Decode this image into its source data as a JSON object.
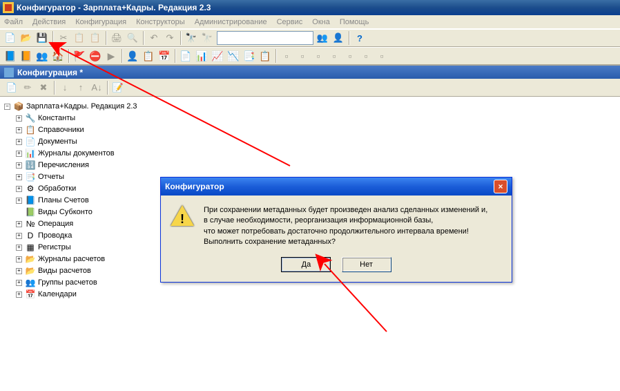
{
  "titlebar": {
    "text": "Конфигуратор - Зарплата+Кадры. Редакция 2.3"
  },
  "menubar": {
    "items": [
      "Файл",
      "Действия",
      "Конфигурация",
      "Конструкторы",
      "Администрирование",
      "Сервис",
      "Окна",
      "Помощь"
    ]
  },
  "subwindow": {
    "title": "Конфигурация *"
  },
  "tree": {
    "root": "Зарплата+Кадры. Редакция 2.3",
    "children": [
      {
        "label": "Константы",
        "icon": "🔧"
      },
      {
        "label": "Справочники",
        "icon": "📋"
      },
      {
        "label": "Документы",
        "icon": "📄"
      },
      {
        "label": "Журналы документов",
        "icon": "📊"
      },
      {
        "label": "Перечисления",
        "icon": "🔢"
      },
      {
        "label": "Отчеты",
        "icon": "📑"
      },
      {
        "label": "Обработки",
        "icon": "⚙"
      },
      {
        "label": "Планы Счетов",
        "icon": "📘"
      },
      {
        "label": "Виды Субконто",
        "icon": "📗",
        "leaf": true
      },
      {
        "label": "Операция",
        "icon": "№"
      },
      {
        "label": "Проводка",
        "icon": "D"
      },
      {
        "label": "Регистры",
        "icon": "▦"
      },
      {
        "label": "Журналы расчетов",
        "icon": "📂"
      },
      {
        "label": "Виды расчетов",
        "icon": "📂"
      },
      {
        "label": "Группы расчетов",
        "icon": "👥"
      },
      {
        "label": "Календари",
        "icon": "📅"
      }
    ]
  },
  "dialog": {
    "title": "Конфигуратор",
    "line1": "При сохранении метаданных будет произведен анализ сделанных  изменений и,",
    "line2": "в случае необходимости, реорганизация информационной базы,",
    "line3": "что может потребовать  достаточно продолжительного интервала времени!",
    "line4": "Выполнить сохранение метаданных?",
    "yes": "Да",
    "no": "Нет"
  }
}
